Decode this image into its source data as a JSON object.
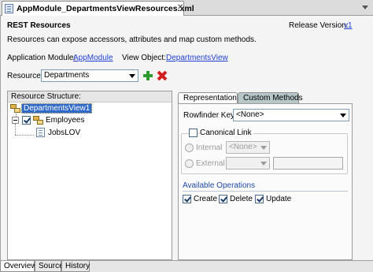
{
  "tab": {
    "title": "AppModule_DepartmentsViewResources.xml",
    "close": "✕"
  },
  "header": {
    "title": "REST Resources",
    "release_label": "Release Version:",
    "release_value": "v1",
    "description": "Resources can expose accessors, attributes and map custom methods."
  },
  "module": {
    "app_label": "Application Module:",
    "app_value": "AppModule",
    "vo_label": "View Object:",
    "vo_value": "DepartmentsView"
  },
  "resource": {
    "label": "Resource:",
    "value": "Departments"
  },
  "structure": {
    "title": "Resource Structure:",
    "nodes": [
      "DepartmentsView1",
      "Employees",
      "JobsLOV"
    ]
  },
  "tabs": {
    "representation": "Representation",
    "custom_methods": "Custom Methods"
  },
  "representation": {
    "rowfinder_label": "Rowfinder Key:",
    "rowfinder_value": "<None>",
    "canonical_label": "Canonical Link",
    "internal_label": "Internal",
    "internal_value": "<None>",
    "external_label": "External",
    "operations_title": "Available Operations",
    "ops": [
      "Create",
      "Delete",
      "Update"
    ]
  },
  "bottom_tabs": [
    "Overview",
    "Source",
    "History"
  ],
  "colors": {
    "link": "#1f3fd6",
    "selection": "#3169c6",
    "section_title": "#1f4aa8",
    "add_green": "#2f9a2f",
    "delete_red": "#d21e1e"
  }
}
